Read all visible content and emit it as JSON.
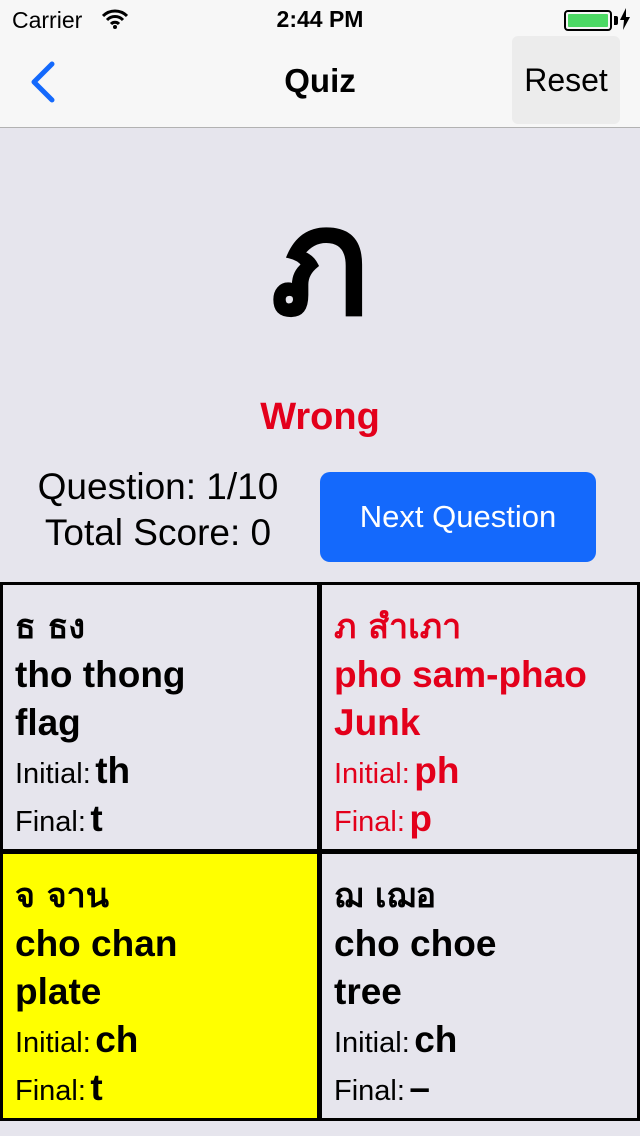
{
  "status_bar": {
    "carrier": "Carrier",
    "time": "2:44 PM"
  },
  "nav": {
    "title": "Quiz",
    "reset_label": "Reset",
    "back_icon": "chevron-left-icon"
  },
  "quiz": {
    "letter": "ภ",
    "result": "Wrong",
    "question": "Question: 1/10",
    "score": "Total Score: 0",
    "next_label": "Next Question"
  },
  "answers": [
    {
      "thai": "ธ ธง",
      "name": "tho thong",
      "meaning": "flag",
      "initial_label": "Initial:",
      "initial": "th",
      "final_label": "Final:",
      "final": "t"
    },
    {
      "thai": "ภ สำเภา",
      "name": "pho sam-phao",
      "meaning": "Junk",
      "initial_label": "Initial:",
      "initial": "ph",
      "final_label": "Final:",
      "final": "p"
    },
    {
      "thai": "จ จาน",
      "name": "cho chan",
      "meaning": "plate",
      "initial_label": "Initial:",
      "initial": "ch",
      "final_label": "Final:",
      "final": "t"
    },
    {
      "thai": "ฌ เฌอ",
      "name": "cho choe",
      "meaning": "tree",
      "initial_label": "Initial:",
      "initial": "ch",
      "final_label": "Final:",
      "final": "–"
    }
  ],
  "colors": {
    "accent": "#1469fc",
    "wrong": "#e3001b",
    "selected": "#ffff00",
    "battery": "#4cd964"
  }
}
